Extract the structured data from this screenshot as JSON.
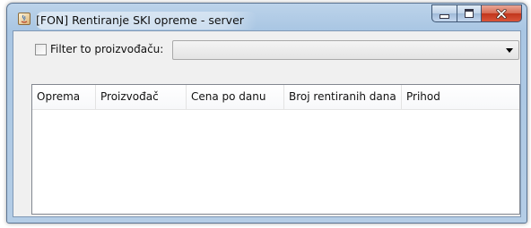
{
  "window": {
    "title": "[FON] Rentiranje SKI opreme - server",
    "buttons": {
      "minimize": "minimize",
      "maximize": "maximize",
      "close": "close"
    }
  },
  "filter": {
    "checkbox_label": "Filter to proizvođaču:",
    "checked": false,
    "selected_value": ""
  },
  "table": {
    "columns": [
      "Oprema",
      "Proizvođač",
      "Cena po danu",
      "Broj rentiranih dana",
      "Prihod"
    ],
    "rows": []
  },
  "colors": {
    "frame": "#b4cde6",
    "client_bg": "#f0f0f0",
    "close_button": "#c1351c"
  }
}
